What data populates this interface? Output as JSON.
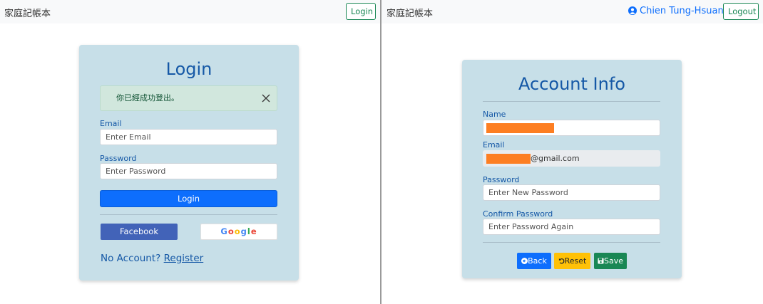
{
  "left": {
    "brand": "家庭記帳本",
    "nav_button": "Login",
    "card": {
      "title": "Login",
      "alert": "你已經成功登出。",
      "email_label": "Email",
      "email_placeholder": "Enter Email",
      "password_label": "Password",
      "password_placeholder": "Enter Password",
      "login_button": "Login",
      "facebook_button": "Facebook",
      "google_letters": [
        "G",
        "o",
        "o",
        "g",
        "l",
        "e"
      ],
      "no_account_text": "No Account?",
      "register_link": "Register"
    }
  },
  "right": {
    "brand": "家庭記帳本",
    "user_name": "Chien Tung-Hsuan",
    "nav_button": "Logout",
    "card": {
      "title": "Account Info",
      "name_label": "Name",
      "email_label": "Email",
      "email_suffix": "@gmail.com",
      "password_label": "Password",
      "password_placeholder": "Enter New Password",
      "confirm_label": "Confirm Password",
      "confirm_placeholder": "Enter Password Again",
      "back_button": "Back",
      "reset_button": "Reset",
      "save_button": "Save"
    }
  },
  "colors": {
    "card_bg": "#c7dfe8",
    "title_blue": "#1558a6",
    "primary": "#0d6efd",
    "success": "#198754",
    "warning": "#ffc107",
    "facebook": "#4263b8",
    "redaction": "#fd7e22",
    "google": [
      "#4285F4",
      "#EA4335",
      "#FBBC05",
      "#4285F4",
      "#34A853",
      "#EA4335"
    ]
  }
}
